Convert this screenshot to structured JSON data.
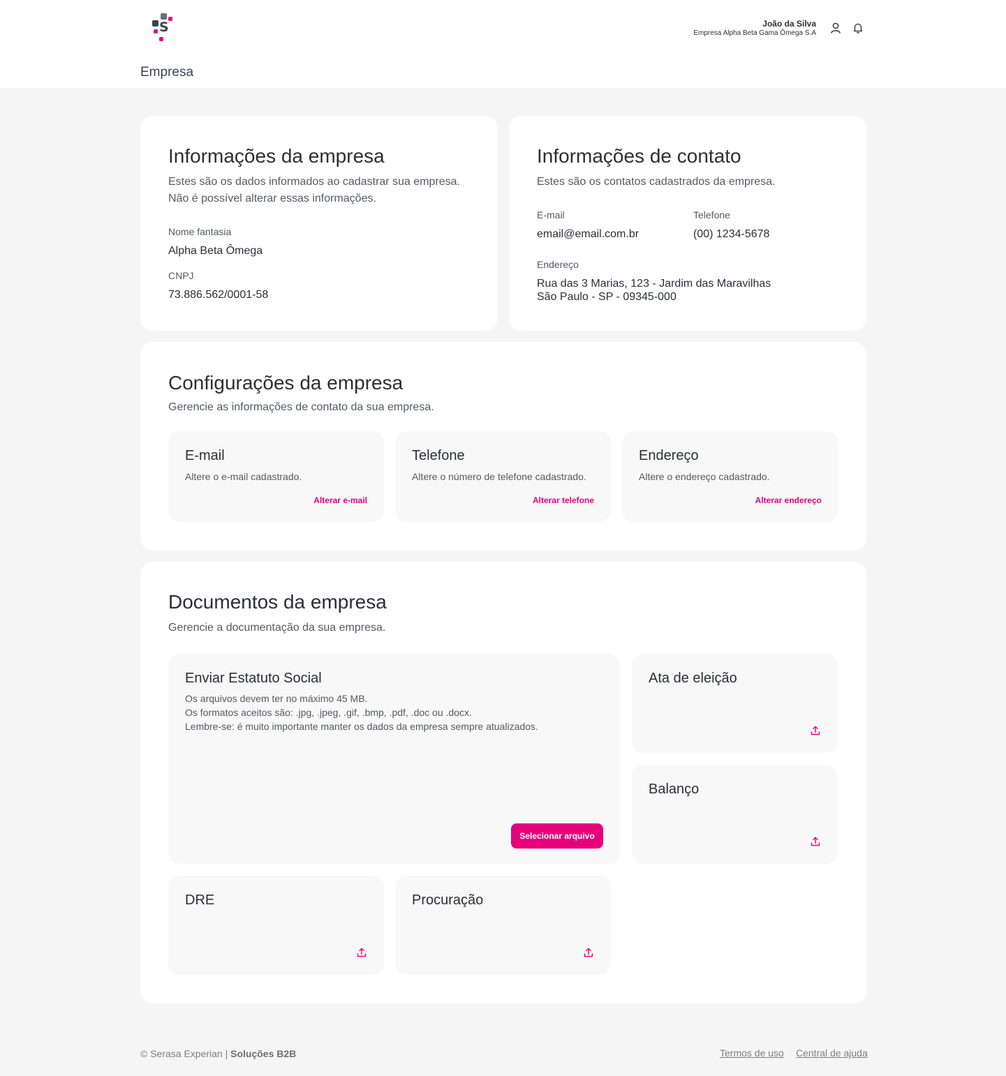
{
  "header": {
    "user_name": "João da Silva",
    "user_company": "Empresa Alpha Beta Gama Ômega S.A",
    "logo_letter": "S",
    "icons": [
      "user-icon",
      "bell-icon"
    ]
  },
  "page_title": "Empresa",
  "company_info": {
    "title": "Informações da empresa",
    "subtitle_line1": "Estes são os dados informados ao cadastrar sua empresa.",
    "subtitle_line2": "Não é possível alterar essas informações.",
    "trade_name_label": "Nome fantasia",
    "trade_name_value": "Alpha Beta Ômega",
    "cnpj_label": "CNPJ",
    "cnpj_value": "73.886.562/0001-58"
  },
  "contact_info": {
    "title": "Informações de contato",
    "subtitle": "Estes são os contatos cadastrados da empresa.",
    "email_label": "E-mail",
    "email_value": "email@email.com.br",
    "phone_label": "Telefone",
    "phone_value": "(00) 1234-5678",
    "address_label": "Endereço",
    "address_line1": "Rua das 3 Marias, 123 - Jardim das Maravilhas",
    "address_line2": "São Paulo - SP - 09345-000"
  },
  "settings": {
    "title": "Configurações da empresa",
    "subtitle": "Gerencie as informações de contato da sua empresa.",
    "cards": [
      {
        "title": "E-mail",
        "desc": "Altere o e-mail cadastrado.",
        "link": "Alterar e-mail"
      },
      {
        "title": "Telefone",
        "desc": "Altere o número de telefone cadastrado.",
        "link": "Alterar telefone"
      },
      {
        "title": "Endereço",
        "desc": "Altere o endereço cadastrado.",
        "link": "Alterar endereço"
      }
    ]
  },
  "documents": {
    "title": "Documentos da empresa",
    "subtitle": "Gerencie a documentação da sua empresa.",
    "statute": {
      "title": "Enviar Estatuto Social",
      "line1": "Os arquivos devem ter no máximo 45 MB.",
      "line2": "Os formatos aceitos são: .jpg, .jpeg, .gif, .bmp, .pdf, .doc ou .docx.",
      "line3": "Lembre-se: é muito importante manter os dados da empresa sempre atualizados.",
      "button": "Selecionar arquivo"
    },
    "items": [
      "Ata de eleição",
      "Balanço",
      "DRE",
      "Procuração"
    ]
  },
  "footer": {
    "copyright": "© Serasa Experian |",
    "brand": "Soluções B2B",
    "links": [
      "Termos de uso",
      "Central de ajuda"
    ]
  },
  "colors": {
    "accent": "#e8007b",
    "background": "#f5f5f6",
    "card": "#ffffff",
    "sub_card": "#f8f8f8",
    "text": "#2b2f36"
  }
}
